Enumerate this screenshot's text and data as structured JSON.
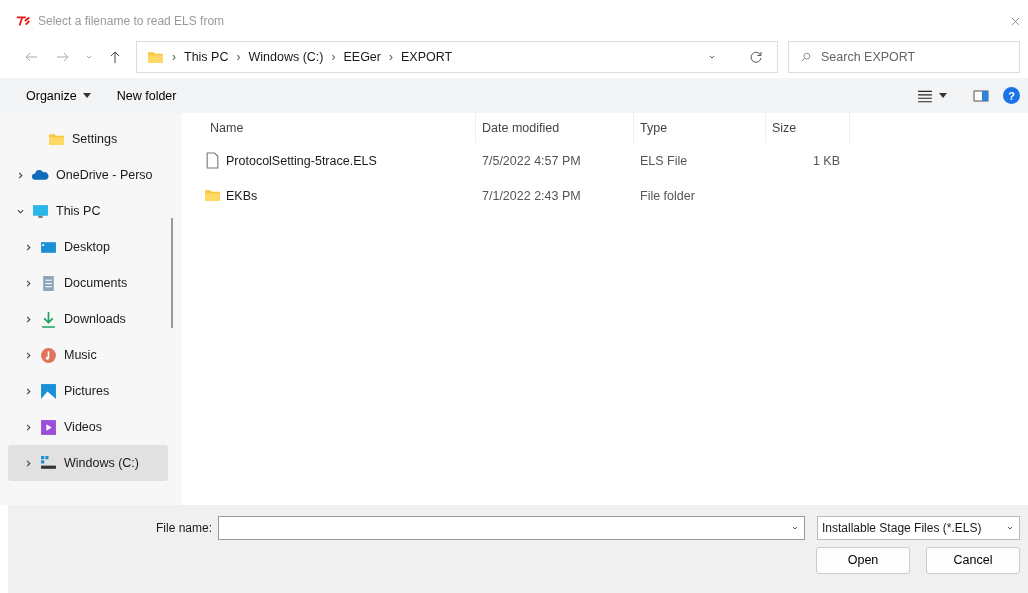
{
  "window": {
    "title": "Select a filename to read ELS from"
  },
  "address": {
    "separator": "›",
    "path": [
      "This PC",
      "Windows (C:)",
      "EEGer",
      "EXPORT"
    ]
  },
  "help": {
    "label": "?"
  },
  "search": {
    "placeholder": "Search EXPORT"
  },
  "toolbar": {
    "buttons": [
      {
        "label": "Organize",
        "dropdown": true
      },
      {
        "label": "New folder",
        "dropdown": false
      }
    ]
  },
  "sidebar": {
    "items": [
      {
        "label": "Settings",
        "kind": "folder",
        "selected": false
      },
      {
        "label": "OneDrive - Perso",
        "kind": "cloud",
        "expanded": false,
        "selected": false
      },
      {
        "label": "This PC",
        "kind": "pc",
        "expanded": true,
        "selected": false,
        "children": [
          {
            "label": "Desktop",
            "kind": "desktop",
            "expanded": false,
            "selected": false
          },
          {
            "label": "Documents",
            "kind": "documents",
            "expanded": false,
            "selected": false
          },
          {
            "label": "Downloads",
            "kind": "downloads",
            "expanded": false,
            "selected": false
          },
          {
            "label": "Music",
            "kind": "music",
            "expanded": false,
            "selected": false
          },
          {
            "label": "Pictures",
            "kind": "pictures",
            "expanded": false,
            "selected": false
          },
          {
            "label": "Videos",
            "kind": "videos",
            "expanded": false,
            "selected": false
          },
          {
            "label": "Windows (C:)",
            "kind": "drive",
            "expanded": false,
            "selected": true
          }
        ]
      }
    ]
  },
  "table": {
    "columns": [
      "Name",
      "Date modified",
      "Type",
      "Size"
    ],
    "rows": [
      {
        "kind": "file",
        "name": "ProtocolSetting-5trace.ELS",
        "date": "7/5/2022 4:57 PM",
        "type": "ELS File",
        "size": "1 KB"
      },
      {
        "kind": "folder",
        "name": "EKBs",
        "date": "7/1/2022 2:43 PM",
        "type": "File folder"
      }
    ]
  },
  "footer": {
    "file_name_label": "File name:",
    "file_type": "Installable Stage Files (*.ELS)",
    "buttons": [
      "Open",
      "Cancel"
    ]
  }
}
